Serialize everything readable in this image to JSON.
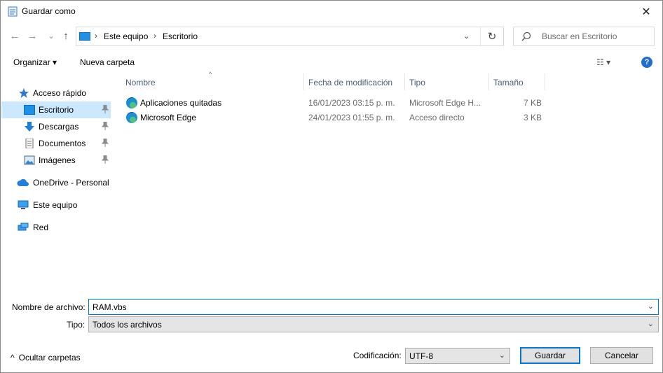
{
  "window": {
    "title": "Guardar como",
    "close_glyph": "✕"
  },
  "nav": {
    "back_glyph": "←",
    "forward_glyph": "→",
    "recent_glyph": "⌄",
    "up_glyph": "↑",
    "breadcrumb": [
      "Este equipo",
      "Escritorio"
    ],
    "separator": "›",
    "refresh_glyph": "↻",
    "dropdown_glyph": "⌄"
  },
  "search": {
    "placeholder": "Buscar en Escritorio"
  },
  "toolbar": {
    "organize": "Organizar ▾",
    "new_folder": "Nueva carpeta",
    "view_glyph": "☷ ▾",
    "help": "?"
  },
  "sidebar": {
    "items": [
      {
        "label": "Acceso rápido",
        "icon": "star-icon"
      },
      {
        "label": "Escritorio",
        "icon": "desktop-icon",
        "pinned": true,
        "selected": true
      },
      {
        "label": "Descargas",
        "icon": "download-icon",
        "pinned": true
      },
      {
        "label": "Documentos",
        "icon": "documents-icon",
        "pinned": true
      },
      {
        "label": "Imágenes",
        "icon": "pictures-icon",
        "pinned": true
      },
      {
        "label": "OneDrive - Personal",
        "icon": "cloud-icon"
      },
      {
        "label": "Este equipo",
        "icon": "computer-icon"
      },
      {
        "label": "Red",
        "icon": "network-icon"
      }
    ],
    "pin_glyph": "📌"
  },
  "files": {
    "columns": [
      "Nombre",
      "Fecha de modificación",
      "Tipo",
      "Tamaño"
    ],
    "sort_glyph": "^",
    "rows": [
      {
        "name": "Aplicaciones quitadas",
        "date": "16/01/2023 03:15 p. m.",
        "type": "Microsoft Edge H...",
        "size": "7 KB"
      },
      {
        "name": "Microsoft Edge",
        "date": "24/01/2023 01:55 p. m.",
        "type": "Acceso directo",
        "size": "3 KB"
      }
    ]
  },
  "form": {
    "filename_label": "Nombre de archivo:",
    "filename_value": "RAM.vbs",
    "type_label": "Tipo:",
    "type_value": "Todos los archivos",
    "encoding_label": "Codificación:",
    "encoding_value": "UTF-8",
    "save": "Guardar",
    "cancel": "Cancelar",
    "hide_folders": "Ocultar carpetas",
    "hide_glyph": "^"
  },
  "colors": {
    "accent": "#0078d7",
    "selection": "#cce8ff",
    "header_text": "#4c607a"
  }
}
